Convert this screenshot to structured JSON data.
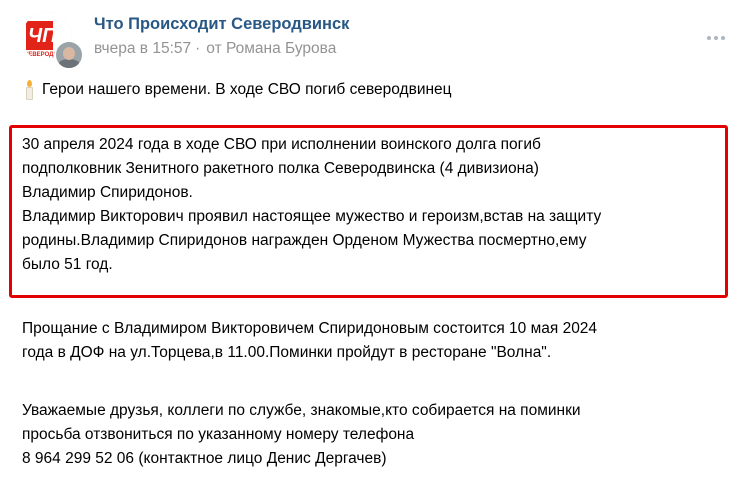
{
  "header": {
    "group_name": "Что Происходит Северодвинск",
    "time": "вчера в 15:57",
    "author": "от Романа Бурова",
    "avatar_logo_text": "ЧП",
    "avatar_logo_subtext": "СЕВЕРОДВ"
  },
  "post": {
    "title": "Герои нашего времени. В ходе СВО погиб северодвинец",
    "highlighted_lines": [
      "30 апреля 2024 года в ходе СВО при исполнении воинского долга погиб",
      "подполковник Зенитного ракетного полка Северодвинска (4 дивизиона)",
      "Владимир Спиридонов.",
      "Владимир Викторович проявил настоящее мужество и героизм,встав на защиту",
      "родины.Владимир Спиридонов награжден Орденом Мужества посмертно,ему",
      "было 51 год."
    ],
    "farewell_lines": [
      "Прощание с Владимиром Викторовичем Спиридоновым состоится 10 мая 2024",
      "года в ДОФ на ул.Торцева,в 11.00.Поминки пройдут в ресторане \"Волна\"."
    ],
    "contact_lines": [
      "Уважаемые друзья, коллеги по службе, знакомые,кто собирается на поминки",
      "просьба отзвониться по указанному номеру телефона",
      "8 964 299 52 06 (контактное лицо Денис Дергачев)"
    ]
  },
  "icons": {
    "candle": "candle-icon",
    "more": "more-dots-icon"
  },
  "colors": {
    "link": "#2a5885",
    "meta": "#939393",
    "highlight_border": "#e30000",
    "logo_red": "#e2231a"
  }
}
